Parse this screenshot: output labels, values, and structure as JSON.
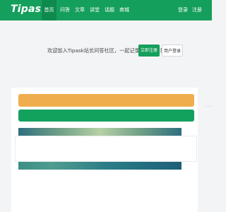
{
  "brand": {
    "logo": "Tipask"
  },
  "nav": {
    "items": [
      {
        "label": "首页",
        "active": true
      },
      {
        "label": "问答",
        "active": false
      },
      {
        "label": "文章",
        "active": false
      },
      {
        "label": "讲堂",
        "active": false
      },
      {
        "label": "话题",
        "active": false
      },
      {
        "label": "商城",
        "active": false
      }
    ],
    "login": "登录",
    "register": "注册"
  },
  "hero": {
    "welcome": "欢迎加入Tipask站长问答社区，一起记录站长的世界",
    "register_button": "立即注册",
    "login_button": "用户登录"
  },
  "colors": {
    "brand_green": "#159f5c",
    "active_nav": "#0e8a4e",
    "warning_orange": "#f0ad4e"
  }
}
